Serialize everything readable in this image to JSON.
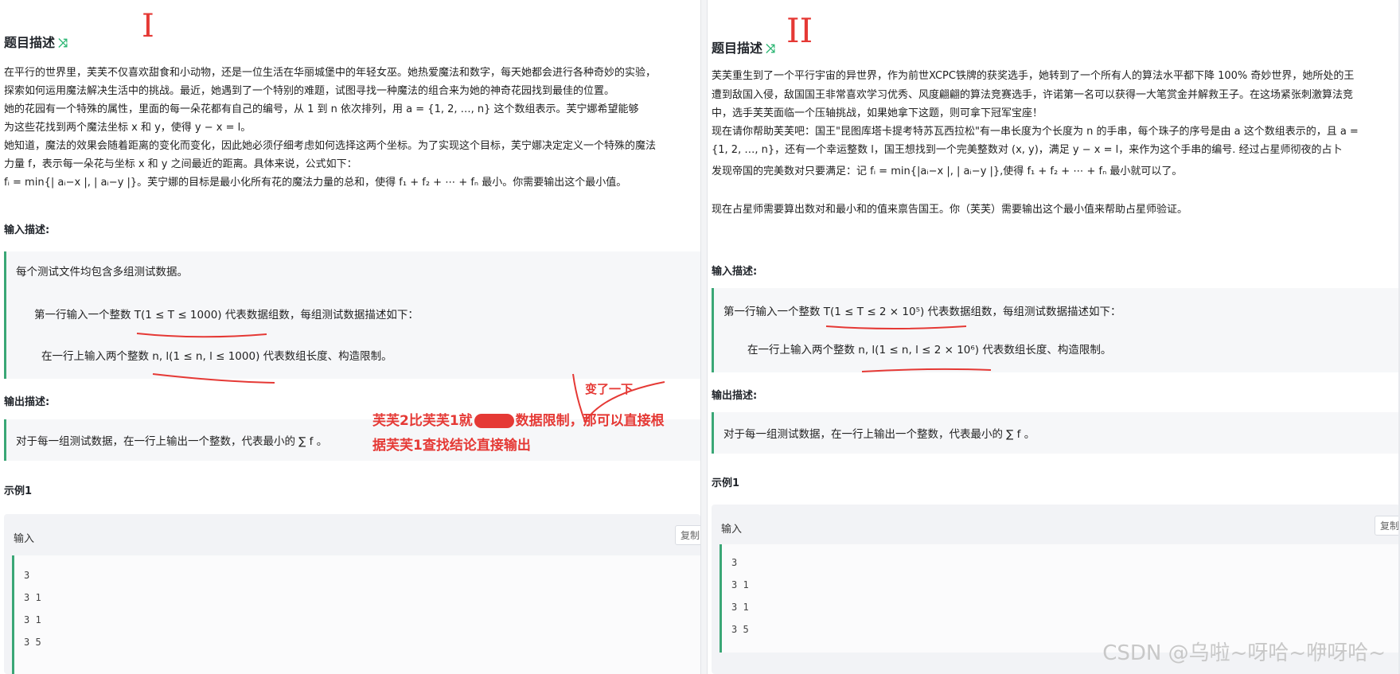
{
  "left": {
    "roman_mark": "I",
    "title": "题目描述",
    "desc_lines": [
      "在平行的世界里，芙芙不仅喜欢甜食和小动物，还是一位生活在华丽城堡中的年轻女巫。她热爱魔法和数字，每天她都会进行各种奇妙的实验，",
      "探索如何运用魔法解决生活中的挑战。最近，她遇到了一个特别的难题，试图寻找一种魔法的组合来为她的神奇花园找到最佳的位置。",
      "她的花园有一个特殊的属性，里面的每一朵花都有自己的编号，从 1 到 n 依次排列，用 a = {1, 2, …, n} 这个数组表示。芙宁娜希望能够",
      "为这些花找到两个魔法坐标 x 和 y，使得 y − x = l。",
      "她知道，魔法的效果会随着距离的变化而变化，因此她必须仔细考虑如何选择这两个坐标。为了实现这个目标，芙宁娜决定定义一个特殊的魔法",
      "力量 f，表示每一朵花与坐标 x 和 y 之间最近的距离。具体来说，公式如下：",
      "fᵢ = min{| aᵢ−x |, | aᵢ−y |}。芙宁娜的目标是最小化所有花的魔法力量的总和，使得 f₁ + f₂ + ⋯ + fₙ 最小。你需要输出这个最小值。"
    ],
    "input_title": "输入描述:",
    "input_line1": "每个测试文件均包含多组测试数据。",
    "input_line2": "第一行输入一个整数  T(1 ≤ T ≤ 1000)  代表数据组数，每组测试数据描述如下：",
    "input_line3": "在一行上输入两个整数  n, l(1 ≤ n, l ≤ 1000)  代表数组长度、构造限制。",
    "output_title": "输出描述:",
    "output_line": "对于每一组测试数据，在一行上输出一个整数，代表最小的  ∑ f  。",
    "example_title": "示例1",
    "sample_input_label": "输入",
    "copy_label": "复制",
    "sample_lines": [
      "3",
      "3 1",
      "3 1",
      "3 5"
    ]
  },
  "right": {
    "roman_mark": "II",
    "title": "题目描述",
    "desc_lines": [
      "芙芙重生到了一个平行宇宙的异世界，作为前世XCPC铁牌的获奖选手，她转到了一个所有人的算法水平都下降 100% 奇妙世界，她所处的王",
      "遭到敌国入侵，敌国国王非常喜欢学习优秀、风度翩翩的算法竞赛选手，许诺第一名可以获得一大笔赏金并解救王子。在这场紧张刺激算法竞",
      "中，选手芙芙面临一个压轴挑战，如果她拿下这题，则可拿下冠军宝座！",
      "现在请你帮助芙芙吧：国王\"昆图库塔卡提考特苏瓦西拉松\"有一串长度为个长度为 n 的手串，每个珠子的序号是由 a 这个数组表示的，且 a =",
      "{1, 2, …, n}，还有一个幸运整数 l，国王想找到一个完美整数对 (x, y)，满足 y − x = l，来作为这个手串的编号. 经过占星师彻夜的占卜",
      "发现帝国的完美数对只要满足：记 fᵢ = min{|aᵢ−x |, | aᵢ−y |},使得 f₁ + f₂ + ⋯ + fₙ 最小就可以了。",
      "",
      "现在占星师需要算出数对和最小和的值来禀告国王。你（芙芙）需要输出这个最小值来帮助占星师验证。"
    ],
    "input_title": "输入描述:",
    "input_line1": "第一行输入一个整数  T(1 ≤ T ≤ 2 × 10⁵)  代表数据组数，每组测试数据描述如下：",
    "input_line2": "在一行上输入两个整数  n, l(1 ≤ n, l ≤ 2 × 10⁶)  代表数组长度、构造限制。",
    "output_title": "输出描述:",
    "output_line": "对于每一组测试数据，在一行上输出一个整数，代表最小的  ∑ f  。",
    "example_title": "示例1",
    "sample_input_label": "输入",
    "copy_label": "复制",
    "sample_lines": [
      "3",
      "3 1",
      "3 1",
      "3 5"
    ]
  },
  "annotations": {
    "changed_note": "变了一下",
    "main_note_line1": "芙芙2比芙芙1就",
    "main_note_line1_tail": "数据限制，那可以直接根",
    "main_note_line2": "据芙芙1查找结论直接输出"
  },
  "watermark": "CSDN @乌啦~呀哈~咿呀哈~",
  "colors": {
    "accent_green": "#3aa776",
    "annotation_red": "#e53935",
    "icon_green": "#2bb673"
  },
  "icons": {
    "title_badge": "shuffle-icon"
  }
}
